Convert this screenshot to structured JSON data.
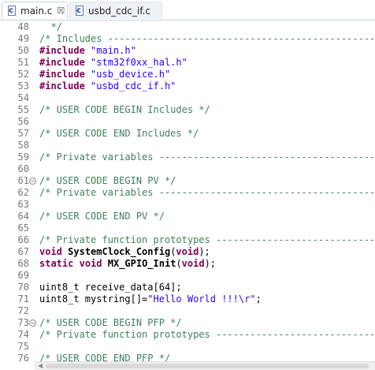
{
  "tabs": [
    {
      "label": "main.c",
      "icon": "c-source-file-icon",
      "close_glyph": "☒",
      "active": true
    },
    {
      "label": "usbd_cdc_if.c",
      "icon": "c-source-file-icon",
      "active": false
    }
  ],
  "file_icon_letter": "c",
  "colors": {
    "comment": "#3f7f5f",
    "keyword": "#7f0055",
    "string": "#2a00ff",
    "line_number": "#787878"
  },
  "fold_glyph": "⊖",
  "lines": [
    {
      "n": "48",
      "seg": [
        {
          "t": "  */",
          "c": "cm"
        }
      ]
    },
    {
      "n": "49",
      "seg": [
        {
          "t": "/* Includes ------------------------------------------------",
          "c": "cm"
        }
      ]
    },
    {
      "n": "50",
      "seg": [
        {
          "t": "#include",
          "c": "pp"
        },
        {
          "t": " ",
          "c": ""
        },
        {
          "t": "\"main.h\"",
          "c": "str"
        }
      ]
    },
    {
      "n": "51",
      "seg": [
        {
          "t": "#include",
          "c": "pp"
        },
        {
          "t": " ",
          "c": ""
        },
        {
          "t": "\"stm32f0xx_hal.h\"",
          "c": "str"
        }
      ]
    },
    {
      "n": "52",
      "seg": [
        {
          "t": "#include",
          "c": "pp"
        },
        {
          "t": " ",
          "c": ""
        },
        {
          "t": "\"usb_device.h\"",
          "c": "str"
        }
      ]
    },
    {
      "n": "53",
      "seg": [
        {
          "t": "#include",
          "c": "pp"
        },
        {
          "t": " ",
          "c": ""
        },
        {
          "t": "\"usbd_cdc_if.h\"",
          "c": "str"
        }
      ]
    },
    {
      "n": "54",
      "seg": []
    },
    {
      "n": "55",
      "seg": [
        {
          "t": "/* USER CODE BEGIN Includes */",
          "c": "cm"
        }
      ]
    },
    {
      "n": "56",
      "seg": []
    },
    {
      "n": "57",
      "seg": [
        {
          "t": "/* USER CODE END Includes */",
          "c": "cm"
        }
      ]
    },
    {
      "n": "58",
      "seg": []
    },
    {
      "n": "59",
      "seg": [
        {
          "t": "/* Private variables -----------------------------------------",
          "c": "cm"
        }
      ]
    },
    {
      "n": "60",
      "seg": []
    },
    {
      "n": "61",
      "fold": true,
      "seg": [
        {
          "t": "/* USER CODE BEGIN PV */",
          "c": "cm"
        }
      ]
    },
    {
      "n": "62",
      "seg": [
        {
          "t": "/* Private variables -----------------------------------------",
          "c": "cm"
        }
      ]
    },
    {
      "n": "63",
      "seg": []
    },
    {
      "n": "64",
      "seg": [
        {
          "t": "/* USER CODE END PV */",
          "c": "cm"
        }
      ]
    },
    {
      "n": "65",
      "seg": []
    },
    {
      "n": "66",
      "seg": [
        {
          "t": "/* Private function prototypes -------------------------------",
          "c": "cm"
        }
      ]
    },
    {
      "n": "67",
      "seg": [
        {
          "t": "void",
          "c": "kw"
        },
        {
          "t": " ",
          "c": ""
        },
        {
          "t": "SystemClock_Config",
          "c": "fn"
        },
        {
          "t": "(",
          "c": ""
        },
        {
          "t": "void",
          "c": "kw"
        },
        {
          "t": ");",
          "c": ""
        }
      ]
    },
    {
      "n": "68",
      "seg": [
        {
          "t": "static",
          "c": "kw"
        },
        {
          "t": " ",
          "c": ""
        },
        {
          "t": "void",
          "c": "kw"
        },
        {
          "t": " ",
          "c": ""
        },
        {
          "t": "MX_GPIO_Init",
          "c": "fn"
        },
        {
          "t": "(",
          "c": ""
        },
        {
          "t": "void",
          "c": "kw"
        },
        {
          "t": ");",
          "c": ""
        }
      ]
    },
    {
      "n": "69",
      "seg": []
    },
    {
      "n": "70",
      "seg": [
        {
          "t": "uint8_t receive_data[64];",
          "c": ""
        }
      ]
    },
    {
      "n": "71",
      "seg": [
        {
          "t": "uint8_t mystring[]=",
          "c": ""
        },
        {
          "t": "\"Hello World !!!\\r\"",
          "c": "str"
        },
        {
          "t": ";",
          "c": ""
        }
      ]
    },
    {
      "n": "72",
      "seg": []
    },
    {
      "n": "73",
      "fold": true,
      "seg": [
        {
          "t": "/* USER CODE BEGIN PFP */",
          "c": "cm"
        }
      ]
    },
    {
      "n": "74",
      "seg": [
        {
          "t": "/* Private function prototypes -------------------------------",
          "c": "cm"
        }
      ]
    },
    {
      "n": "75",
      "seg": []
    },
    {
      "n": "76",
      "seg": [
        {
          "t": "/* USER CODE END PFP */",
          "c": "cm"
        }
      ]
    }
  ],
  "scrollbar": {
    "left_arrow": "◀"
  }
}
